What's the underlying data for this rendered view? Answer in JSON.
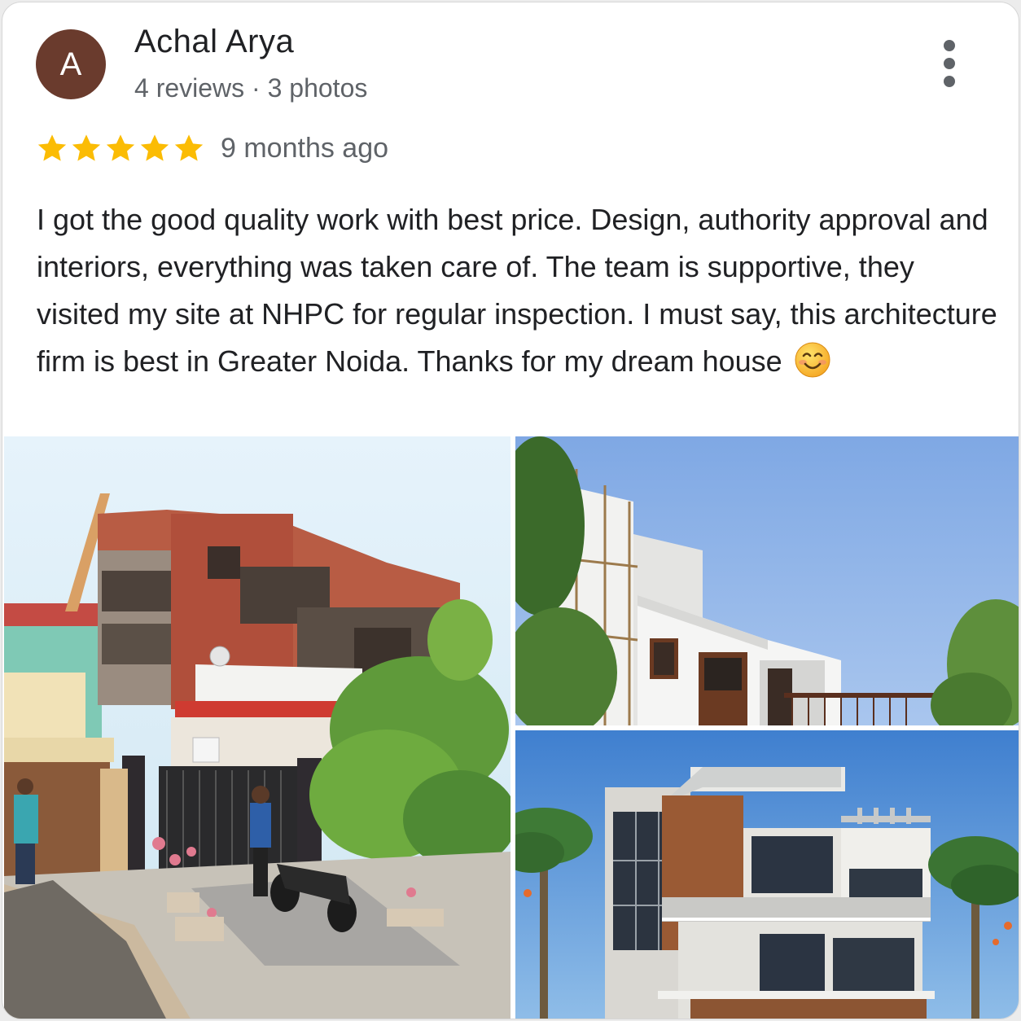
{
  "reviewer": {
    "avatar_letter": "A",
    "name": "Achal Arya",
    "meta": "4 reviews · 3 photos"
  },
  "rating": {
    "stars": 5,
    "max": 5,
    "time": "9 months ago"
  },
  "review_text": "I got the good quality work with best price. Design, authority approval and interiors, everything was taken care of. The team is supportive, they visited my site at NHPC for regular inspection. I must say, this architecture firm is best in Greater Noida. Thanks for my dream house",
  "colors": {
    "avatar_bg": "#6a3b2d",
    "star": "#fbbc04",
    "text_primary": "#202124",
    "text_secondary": "#5f6368"
  },
  "icons": [
    "more-vert-icon",
    "star-icon",
    "smiling-face-emoji"
  ],
  "photos": [
    {
      "id": "under-construction-house"
    },
    {
      "id": "white-house-scaffolding"
    },
    {
      "id": "modern-house-render"
    }
  ]
}
